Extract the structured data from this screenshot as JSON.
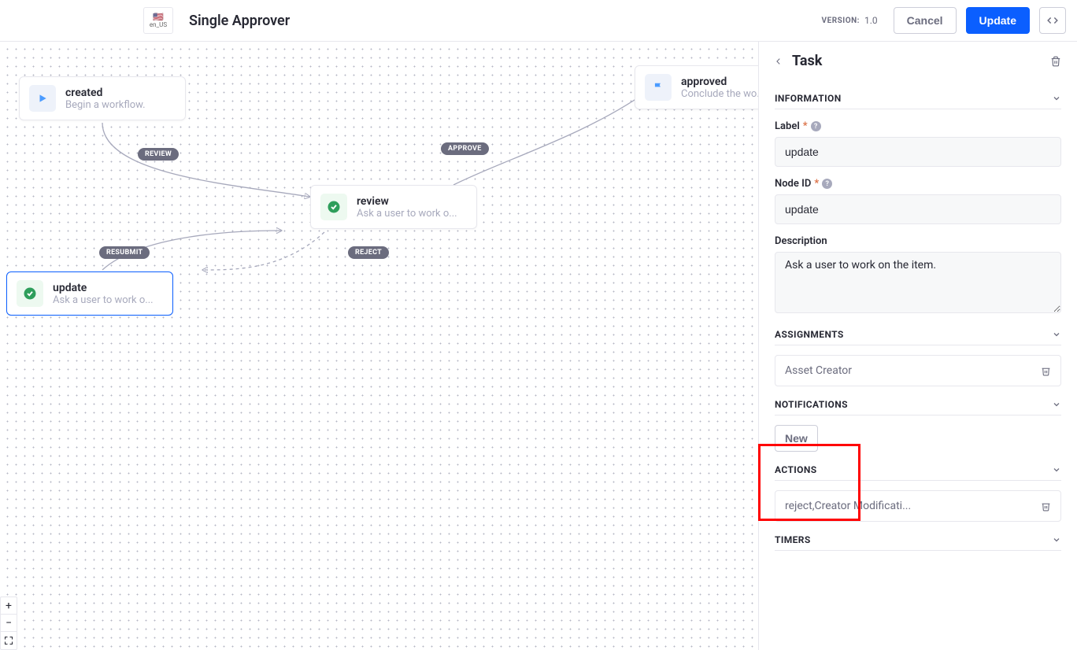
{
  "header": {
    "locale": "en_US",
    "title": "Single Approver",
    "version_label": "VERSION:",
    "version_value": "1.0",
    "cancel": "Cancel",
    "update": "Update"
  },
  "canvas": {
    "nodes": {
      "created": {
        "title": "created",
        "desc": "Begin a workflow."
      },
      "review": {
        "title": "review",
        "desc": "Ask a user to work o..."
      },
      "update": {
        "title": "update",
        "desc": "Ask a user to work o..."
      },
      "approved": {
        "title": "approved",
        "desc": "Conclude the wo..."
      }
    },
    "edges": {
      "review": "REVIEW",
      "approve": "APPROVE",
      "reject": "REJECT",
      "resubmit": "RESUBMIT"
    }
  },
  "sidebar": {
    "title": "Task",
    "sections": {
      "information": "INFORMATION",
      "assignments": "ASSIGNMENTS",
      "notifications": "NOTIFICATIONS",
      "actions": "ACTIONS",
      "timers": "TIMERS"
    },
    "form": {
      "label_label": "Label",
      "label_value": "update",
      "nodeid_label": "Node ID",
      "nodeid_value": "update",
      "desc_label": "Description",
      "desc_value": "Ask a user to work on the item."
    },
    "assignments_item": "Asset Creator",
    "notifications_new": "New",
    "actions_item": "reject,Creator Modificati..."
  }
}
